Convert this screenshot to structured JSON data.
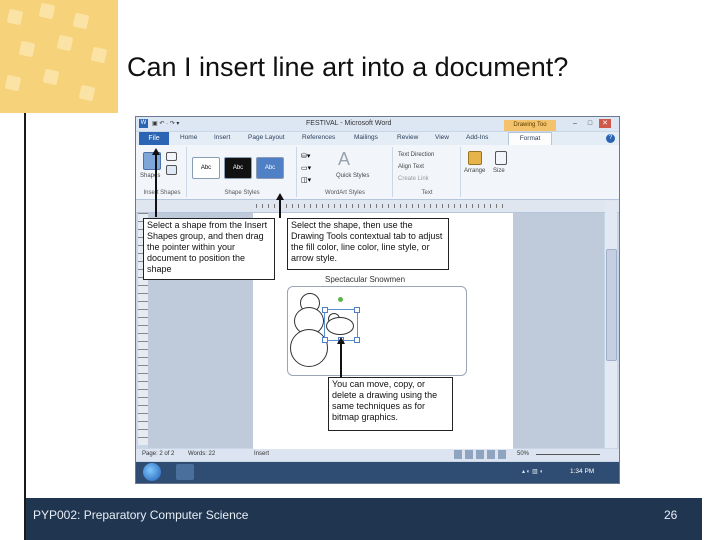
{
  "slide": {
    "title": "Can I insert line art into a document?",
    "footer": "PYP002: Preparatory Computer Science",
    "page_number": "26"
  },
  "word": {
    "window_title": "FESTIVAL - Microsoft Word",
    "contextual_tab": "Drawing Too",
    "tabs": [
      "File",
      "Home",
      "Insert",
      "Page Layout",
      "References",
      "Mailings",
      "Review",
      "View",
      "Add-Ins",
      "Format"
    ],
    "ribbon": {
      "shapes_label": "Shapes",
      "insert_shapes_group": "Insert Shapes",
      "shape_styles_group": "Shape Styles",
      "style_samples": [
        "Abc",
        "Abc",
        "Abc"
      ],
      "quick_styles": "Quick Styles",
      "wordart_group": "WordArt Styles",
      "text_direction": "Text Direction",
      "align_text": "Align Text",
      "create_link": "Create Link",
      "text_group": "Text",
      "arrange": "Arrange",
      "size": "Size"
    },
    "document": {
      "caption": "Spectacular Snowmen"
    },
    "status": {
      "page": "Page: 2 of 2",
      "words": "Words: 22",
      "mode": "Insert",
      "zoom": "50%"
    },
    "taskbar_time": "1:34 PM"
  },
  "callouts": {
    "insert_shape": "Select a shape from the Insert Shapes group, and then drag the pointer within your document to position the shape",
    "drawing_tools": "Select the shape, then use the Drawing Tools contextual tab to adjust the fill color, line color, line style, or arrow style.",
    "move_copy": "You can move, copy, or delete a drawing using the same techniques as for bitmap graphics."
  },
  "colors": {
    "footer_bg": "#1f3550",
    "accent": "#f6d27a",
    "file_tab": "#2a64b3"
  }
}
